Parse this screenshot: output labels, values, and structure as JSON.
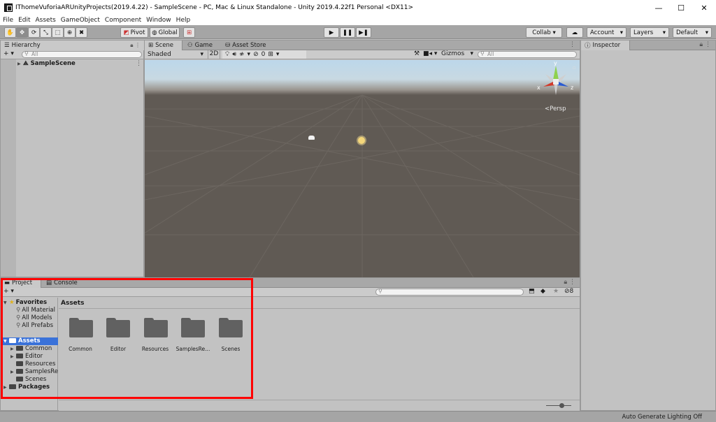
{
  "window": {
    "title": "IThomeVuforiaARUnityProjects(2019.4.22) - SampleScene - PC, Mac & Linux Standalone - Unity 2019.4.22f1 Personal <DX11>",
    "controls": [
      "—",
      "☐",
      "✕"
    ]
  },
  "menu": [
    "File",
    "Edit",
    "Assets",
    "GameObject",
    "Component",
    "Window",
    "Help"
  ],
  "toolbar": {
    "pivot": "Pivot",
    "global": "Global",
    "collab": "Collab ▾",
    "account": "Account",
    "layers": "Layers",
    "layout": "Default"
  },
  "hierarchy": {
    "tab": "Hierarchy",
    "add": "+ ▾",
    "search_placeholder": "All",
    "scene": "SampleScene"
  },
  "scene_view": {
    "tabs": [
      "Scene",
      "Game",
      "Asset Store"
    ],
    "shading": "Shaded",
    "mode_2d": "2D",
    "hidden_count": "0",
    "gizmos": "Gizmos",
    "search_placeholder": "All",
    "persp": "Persp",
    "axis_x": "x",
    "axis_y": "y",
    "axis_z": "z"
  },
  "inspector": {
    "tab": "Inspector"
  },
  "project": {
    "tabs": [
      "Project",
      "Console"
    ],
    "add": "+ ▾",
    "count": "8",
    "favorites": {
      "label": "Favorites",
      "items": [
        "All Material",
        "All Models",
        "All Prefabs"
      ]
    },
    "assets_root": "Assets",
    "asset_tree": [
      "Common",
      "Editor",
      "Resources",
      "SamplesRe",
      "Scenes"
    ],
    "packages": "Packages",
    "breadcrumb": "Assets",
    "grid_items": [
      "Common",
      "Editor",
      "Resources",
      "SamplesRe...",
      "Scenes"
    ]
  },
  "status_bar": {
    "text": "Auto Generate Lighting Off"
  },
  "colors": {
    "highlight": "#ff0000",
    "selection": "#3a72d9",
    "scene_ground": "#605a54",
    "sky_top": "#bcd7ea"
  }
}
